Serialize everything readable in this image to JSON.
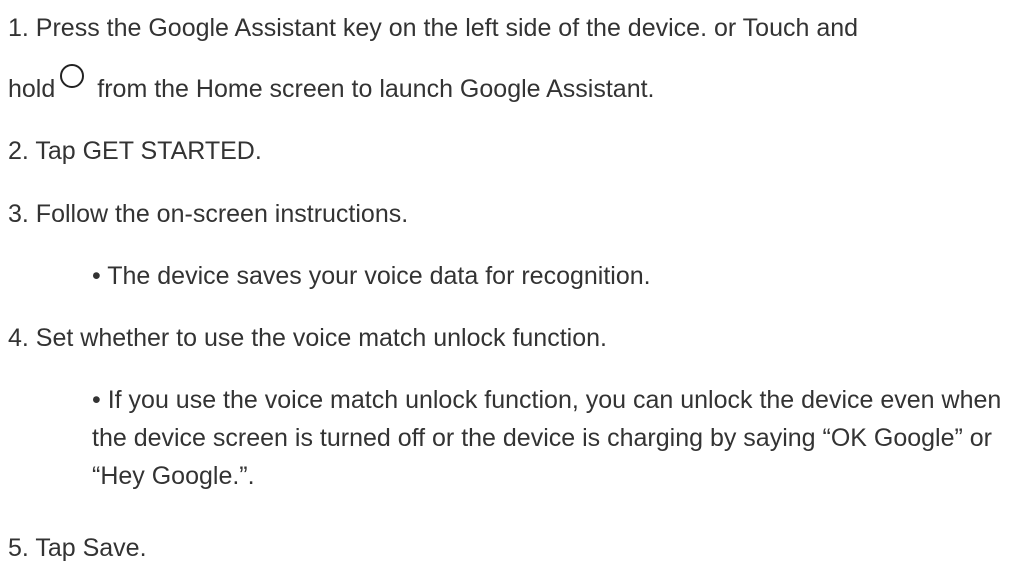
{
  "steps": [
    {
      "line1": "1. Press the Google Assistant key on the left side of the device. or Touch and",
      "line2_before_icon": "hold",
      "icon": "circle-home-icon",
      "line2_after_icon": "from the Home screen to launch Google Assistant."
    },
    {
      "text": "2. Tap GET STARTED."
    },
    {
      "text": "3. Follow the on-screen instructions."
    },
    {
      "text": "4. Set whether to use the voice match unlock function."
    },
    {
      "text": "5. Tap Save."
    }
  ],
  "notes": [
    {
      "text": "• The device saves your voice data for recognition."
    },
    {
      "text": "• If you use the voice match unlock function, you can unlock the device even when the device screen is turned off or the device is charging by saying “OK Google” or “Hey Google.”."
    }
  ]
}
